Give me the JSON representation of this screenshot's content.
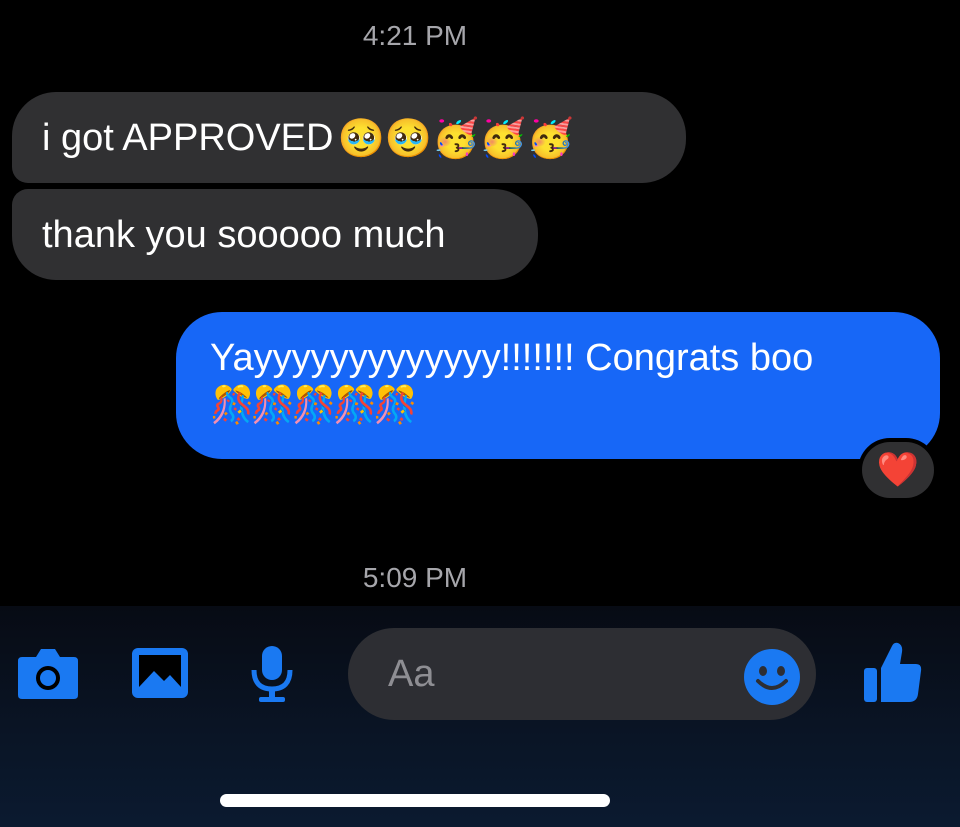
{
  "timestamps": [
    "4:21 PM",
    "5:09 PM"
  ],
  "messages": {
    "incoming_1": {
      "text": "i got APPROVED",
      "emoji": "🥹🥹🥳🥳🥳"
    },
    "incoming_2": {
      "text": "thank you sooooo much"
    },
    "outgoing_1": {
      "text": "Yayyyyyyyyyyyyy!!!!!!! Congrats boo",
      "emoji": "🎊🎊🎊🎊🎊"
    }
  },
  "reaction": {
    "emoji": "❤️"
  },
  "composer": {
    "placeholder": "Aa",
    "icons": [
      "camera-icon",
      "image-icon",
      "microphone-icon",
      "emoji-icon",
      "thumbs-up-icon"
    ],
    "accent_color": "#1a79f2"
  },
  "colors": {
    "incoming_bubble": "#303032",
    "outgoing_bubble": "#1767f7",
    "timestamp": "#a6a6ab"
  }
}
